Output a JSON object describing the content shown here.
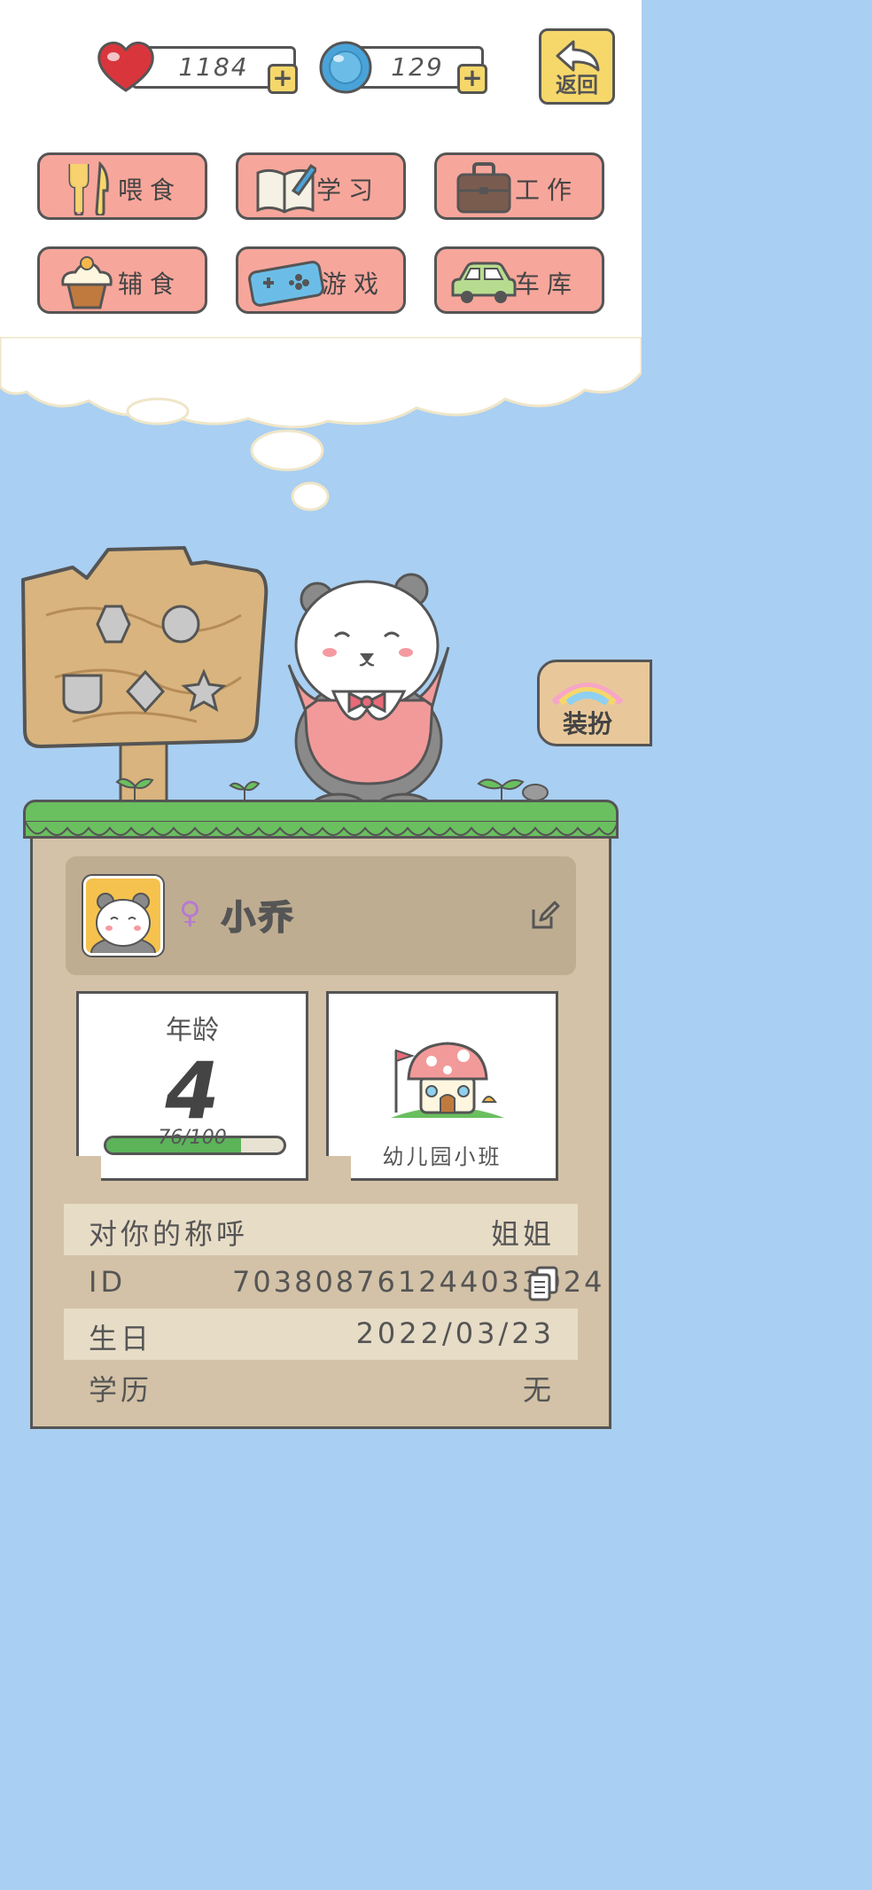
{
  "header": {
    "hearts": {
      "value": "1184",
      "icon": "heart-icon"
    },
    "coins": {
      "value": "129",
      "icon": "bottle-cap-icon"
    },
    "back_label": "返回"
  },
  "menu": [
    {
      "label": "喂食",
      "icon": "fork-knife-icon"
    },
    {
      "label": "学习",
      "icon": "book-pen-icon"
    },
    {
      "label": "工作",
      "icon": "briefcase-icon"
    },
    {
      "label": "辅食",
      "icon": "cupcake-icon"
    },
    {
      "label": "游戏",
      "icon": "gamepad-icon"
    },
    {
      "label": "车库",
      "icon": "car-icon"
    }
  ],
  "dress_up_label": "装扮",
  "profile": {
    "gender_symbol": "♀",
    "name": "小乔"
  },
  "age_card": {
    "title": "年龄",
    "age": "4",
    "progress_text": "76/100",
    "progress": 0.76
  },
  "school_card": {
    "label": "幼儿园小班"
  },
  "info": {
    "title_key": "对你的称呼",
    "title_value": "姐姐",
    "id_key": "ID",
    "id_value": "703808761244033024",
    "birthday_key": "生日",
    "birthday_value": "2022/03/23",
    "education_key": "学历",
    "education_value": "无"
  },
  "colors": {
    "sky": "#a9cff2",
    "menu_button": "#f7a69b",
    "yellow_button": "#f6d76a",
    "grass": "#6abf5f",
    "panel": "#d3c2a7"
  }
}
